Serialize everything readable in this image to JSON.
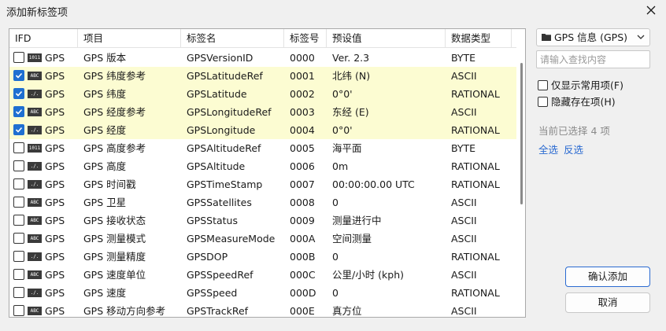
{
  "dialog": {
    "title": "添加新标签项"
  },
  "columns": [
    "IFD",
    "项目",
    "标签名",
    "标签号",
    "预设值",
    "数据类型"
  ],
  "rows": [
    {
      "checked": false,
      "icon": "1011",
      "ifd": "GPS",
      "item": "GPS 版本",
      "tag": "GPSVersionID",
      "num": "0000",
      "value": "Ver. 2.3",
      "type": "BYTE"
    },
    {
      "checked": true,
      "icon": "ABC",
      "ifd": "GPS",
      "item": "GPS 纬度参考",
      "tag": "GPSLatitudeRef",
      "num": "0001",
      "value": "北纬 (N)",
      "type": "ASCII"
    },
    {
      "checked": true,
      "icon": "./.",
      "ifd": "GPS",
      "item": "GPS 纬度",
      "tag": "GPSLatitude",
      "num": "0002",
      "value": "0°0'",
      "type": "RATIONAL"
    },
    {
      "checked": true,
      "icon": "ABC",
      "ifd": "GPS",
      "item": "GPS 经度参考",
      "tag": "GPSLongitudeRef",
      "num": "0003",
      "value": "东经 (E)",
      "type": "ASCII"
    },
    {
      "checked": true,
      "icon": "./.",
      "ifd": "GPS",
      "item": "GPS 经度",
      "tag": "GPSLongitude",
      "num": "0004",
      "value": "0°0'",
      "type": "RATIONAL"
    },
    {
      "checked": false,
      "icon": "1011",
      "ifd": "GPS",
      "item": "GPS 高度参考",
      "tag": "GPSAltitudeRef",
      "num": "0005",
      "value": "海平面",
      "type": "BYTE"
    },
    {
      "checked": false,
      "icon": "./.",
      "ifd": "GPS",
      "item": "GPS 高度",
      "tag": "GPSAltitude",
      "num": "0006",
      "value": "0m",
      "type": "RATIONAL"
    },
    {
      "checked": false,
      "icon": "./.",
      "ifd": "GPS",
      "item": "GPS 时间戳",
      "tag": "GPSTimeStamp",
      "num": "0007",
      "value": "00:00:00.00 UTC",
      "type": "RATIONAL"
    },
    {
      "checked": false,
      "icon": "ABC",
      "ifd": "GPS",
      "item": "GPS 卫星",
      "tag": "GPSSatellites",
      "num": "0008",
      "value": "0",
      "type": "ASCII"
    },
    {
      "checked": false,
      "icon": "ABC",
      "ifd": "GPS",
      "item": "GPS 接收状态",
      "tag": "GPSStatus",
      "num": "0009",
      "value": "测量进行中",
      "type": "ASCII"
    },
    {
      "checked": false,
      "icon": "ABC",
      "ifd": "GPS",
      "item": "GPS 测量模式",
      "tag": "GPSMeasureMode",
      "num": "000A",
      "value": "空间测量",
      "type": "ASCII"
    },
    {
      "checked": false,
      "icon": "./.",
      "ifd": "GPS",
      "item": "GPS 测量精度",
      "tag": "GPSDOP",
      "num": "000B",
      "value": "0",
      "type": "RATIONAL"
    },
    {
      "checked": false,
      "icon": "ABC",
      "ifd": "GPS",
      "item": "GPS 速度单位",
      "tag": "GPSSpeedRef",
      "num": "000C",
      "value": "公里/小时 (kph)",
      "type": "ASCII"
    },
    {
      "checked": false,
      "icon": "./.",
      "ifd": "GPS",
      "item": "GPS 速度",
      "tag": "GPSSpeed",
      "num": "000D",
      "value": "0",
      "type": "RATIONAL"
    },
    {
      "checked": false,
      "icon": "ABC",
      "ifd": "GPS",
      "item": "GPS 移动方向参考",
      "tag": "GPSTrackRef",
      "num": "000E",
      "value": "真方位",
      "type": "ASCII"
    }
  ],
  "sidebar": {
    "group_select": "GPS 信息 (GPS)",
    "search_placeholder": "请输入查找内容",
    "opt_common": "仅显示常用项(F)",
    "opt_hide_existing": "隐藏存在项(H)",
    "selected_info": "当前已选择 4 项",
    "select_all": "全选",
    "invert": "反选"
  },
  "buttons": {
    "confirm": "确认添加",
    "cancel": "取消"
  },
  "colors": {
    "checked_row": "#fcfcd2",
    "accent": "#1f6fd1",
    "link": "#2a6ad1"
  }
}
